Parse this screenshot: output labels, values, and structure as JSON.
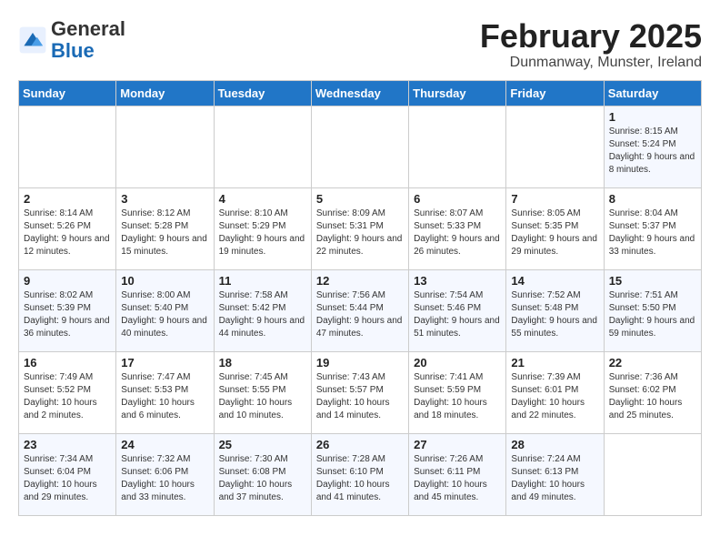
{
  "header": {
    "logo_general": "General",
    "logo_blue": "Blue",
    "month_title": "February 2025",
    "location": "Dunmanway, Munster, Ireland"
  },
  "days_of_week": [
    "Sunday",
    "Monday",
    "Tuesday",
    "Wednesday",
    "Thursday",
    "Friday",
    "Saturday"
  ],
  "weeks": [
    [
      {
        "day": "",
        "info": ""
      },
      {
        "day": "",
        "info": ""
      },
      {
        "day": "",
        "info": ""
      },
      {
        "day": "",
        "info": ""
      },
      {
        "day": "",
        "info": ""
      },
      {
        "day": "",
        "info": ""
      },
      {
        "day": "1",
        "info": "Sunrise: 8:15 AM\nSunset: 5:24 PM\nDaylight: 9 hours and 8 minutes."
      }
    ],
    [
      {
        "day": "2",
        "info": "Sunrise: 8:14 AM\nSunset: 5:26 PM\nDaylight: 9 hours and 12 minutes."
      },
      {
        "day": "3",
        "info": "Sunrise: 8:12 AM\nSunset: 5:28 PM\nDaylight: 9 hours and 15 minutes."
      },
      {
        "day": "4",
        "info": "Sunrise: 8:10 AM\nSunset: 5:29 PM\nDaylight: 9 hours and 19 minutes."
      },
      {
        "day": "5",
        "info": "Sunrise: 8:09 AM\nSunset: 5:31 PM\nDaylight: 9 hours and 22 minutes."
      },
      {
        "day": "6",
        "info": "Sunrise: 8:07 AM\nSunset: 5:33 PM\nDaylight: 9 hours and 26 minutes."
      },
      {
        "day": "7",
        "info": "Sunrise: 8:05 AM\nSunset: 5:35 PM\nDaylight: 9 hours and 29 minutes."
      },
      {
        "day": "8",
        "info": "Sunrise: 8:04 AM\nSunset: 5:37 PM\nDaylight: 9 hours and 33 minutes."
      }
    ],
    [
      {
        "day": "9",
        "info": "Sunrise: 8:02 AM\nSunset: 5:39 PM\nDaylight: 9 hours and 36 minutes."
      },
      {
        "day": "10",
        "info": "Sunrise: 8:00 AM\nSunset: 5:40 PM\nDaylight: 9 hours and 40 minutes."
      },
      {
        "day": "11",
        "info": "Sunrise: 7:58 AM\nSunset: 5:42 PM\nDaylight: 9 hours and 44 minutes."
      },
      {
        "day": "12",
        "info": "Sunrise: 7:56 AM\nSunset: 5:44 PM\nDaylight: 9 hours and 47 minutes."
      },
      {
        "day": "13",
        "info": "Sunrise: 7:54 AM\nSunset: 5:46 PM\nDaylight: 9 hours and 51 minutes."
      },
      {
        "day": "14",
        "info": "Sunrise: 7:52 AM\nSunset: 5:48 PM\nDaylight: 9 hours and 55 minutes."
      },
      {
        "day": "15",
        "info": "Sunrise: 7:51 AM\nSunset: 5:50 PM\nDaylight: 9 hours and 59 minutes."
      }
    ],
    [
      {
        "day": "16",
        "info": "Sunrise: 7:49 AM\nSunset: 5:52 PM\nDaylight: 10 hours and 2 minutes."
      },
      {
        "day": "17",
        "info": "Sunrise: 7:47 AM\nSunset: 5:53 PM\nDaylight: 10 hours and 6 minutes."
      },
      {
        "day": "18",
        "info": "Sunrise: 7:45 AM\nSunset: 5:55 PM\nDaylight: 10 hours and 10 minutes."
      },
      {
        "day": "19",
        "info": "Sunrise: 7:43 AM\nSunset: 5:57 PM\nDaylight: 10 hours and 14 minutes."
      },
      {
        "day": "20",
        "info": "Sunrise: 7:41 AM\nSunset: 5:59 PM\nDaylight: 10 hours and 18 minutes."
      },
      {
        "day": "21",
        "info": "Sunrise: 7:39 AM\nSunset: 6:01 PM\nDaylight: 10 hours and 22 minutes."
      },
      {
        "day": "22",
        "info": "Sunrise: 7:36 AM\nSunset: 6:02 PM\nDaylight: 10 hours and 25 minutes."
      }
    ],
    [
      {
        "day": "23",
        "info": "Sunrise: 7:34 AM\nSunset: 6:04 PM\nDaylight: 10 hours and 29 minutes."
      },
      {
        "day": "24",
        "info": "Sunrise: 7:32 AM\nSunset: 6:06 PM\nDaylight: 10 hours and 33 minutes."
      },
      {
        "day": "25",
        "info": "Sunrise: 7:30 AM\nSunset: 6:08 PM\nDaylight: 10 hours and 37 minutes."
      },
      {
        "day": "26",
        "info": "Sunrise: 7:28 AM\nSunset: 6:10 PM\nDaylight: 10 hours and 41 minutes."
      },
      {
        "day": "27",
        "info": "Sunrise: 7:26 AM\nSunset: 6:11 PM\nDaylight: 10 hours and 45 minutes."
      },
      {
        "day": "28",
        "info": "Sunrise: 7:24 AM\nSunset: 6:13 PM\nDaylight: 10 hours and 49 minutes."
      },
      {
        "day": "",
        "info": ""
      }
    ]
  ]
}
